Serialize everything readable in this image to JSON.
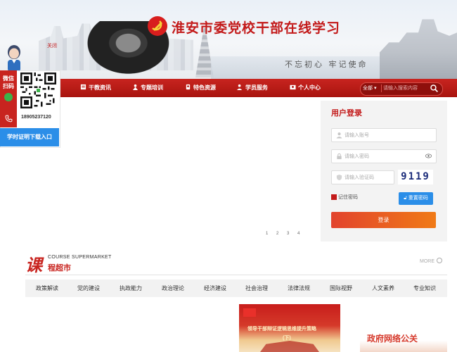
{
  "header": {
    "site_title": "淮安市委党校干部在线学习",
    "calligraphy": "不忘初心 牢记使命"
  },
  "nav": {
    "items": [
      {
        "label": "干教资讯",
        "icon": "news-icon"
      },
      {
        "label": "专题培训",
        "icon": "training-icon"
      },
      {
        "label": "特色资源",
        "icon": "resource-icon"
      },
      {
        "label": "学员服务",
        "icon": "student-icon"
      },
      {
        "label": "个人中心",
        "icon": "profile-icon"
      }
    ],
    "search": {
      "scope": "全部",
      "placeholder": "请输入搜索内容"
    }
  },
  "side": {
    "close": "关闭",
    "wechat_label_1": "微信",
    "wechat_label_2": "扫码",
    "phone": "18905237120",
    "certificate": "学时证明下载入口"
  },
  "pager": [
    "1",
    "2",
    "3",
    "4"
  ],
  "login": {
    "title": "用户登录",
    "username_placeholder": "请输入账号",
    "password_placeholder": "请输入密码",
    "captcha_placeholder": "请输入验证码",
    "captcha_code": "9119",
    "remember": "记住密码",
    "reset": "重置密码",
    "submit": "登录"
  },
  "courses": {
    "glyph": "课",
    "title_en": "COURSE SUPERMARKET",
    "title_cn": "程超市",
    "more": "MORE",
    "categories": [
      "政策解读",
      "党的建设",
      "执政能力",
      "政治理论",
      "经济建设",
      "社会治理",
      "法律法规",
      "国际视野",
      "人文素养",
      "专业知识"
    ],
    "card1_line1": "领导干部辩证逻辑思维提升策略",
    "card1_line2": "(下)",
    "card2_title": "政府网络公关"
  },
  "colors": {
    "brand_red": "#c8241f",
    "accent_blue": "#2b8ee8",
    "login_orange": "#f07a16"
  }
}
